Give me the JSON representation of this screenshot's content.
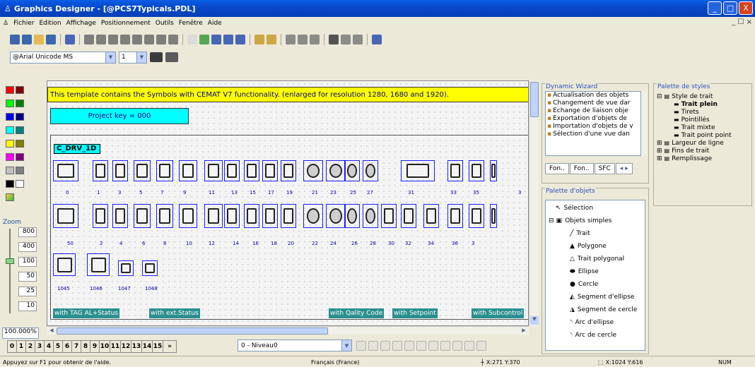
{
  "window": {
    "title": "Graphics Designer - [@PCS7Typicals.PDL]",
    "min": "_",
    "max": "□",
    "close": "X",
    "mdi_controls": "_ ☐ ×"
  },
  "menu": [
    "Fichier",
    "Edition",
    "Affichage",
    "Positionnement",
    "Outils",
    "Fenêtre",
    "Aide"
  ],
  "format_bar": {
    "font": "@Arial Unicode MS",
    "line_width": "1"
  },
  "canvas": {
    "banner": "This template contains the Symbols with CEMAT V7 functionality. (enlarged for  resolution 1280, 1680 and 1920).",
    "project_key": "Project key = 000",
    "group_label": "C_DRV_1D",
    "row1_numbers": [
      "0",
      "1",
      "3",
      "5",
      "7",
      "9",
      "11",
      "13",
      "15",
      "17",
      "19",
      "21",
      "23",
      "25",
      "27",
      "31",
      "33",
      "35",
      "3"
    ],
    "row2_numbers": [
      "50",
      "2",
      "4",
      "6",
      "8",
      "10",
      "12",
      "14",
      "16",
      "18",
      "20",
      "22",
      "24",
      "26",
      "28",
      "30",
      "32",
      "34",
      "36",
      "3"
    ],
    "row3_numbers": [
      "1045",
      "1046",
      "1047",
      "1048"
    ],
    "tags": [
      "with TAG  AL+Status",
      "with ext.Status",
      "with Qality Code",
      "with Setpoint",
      "with Subcontrol"
    ]
  },
  "zoom": {
    "label": "Zoom",
    "levels": [
      "800",
      "400",
      "100",
      "50",
      "25",
      "10"
    ],
    "value": "100.000",
    "unit": "%"
  },
  "dynamic_wizard": {
    "title": "Dynamic Wizard",
    "items": [
      "Actualisation des objets",
      "Changement de vue dar",
      "Echange de liaison obje",
      "Exportation d'objets de",
      "Importation d'objets de v",
      "Sélection d'une vue dan"
    ],
    "tabs": [
      "Fon..",
      "Fon..",
      "SFC"
    ]
  },
  "style_palette": {
    "title": "Palette de styles",
    "items": [
      {
        "label": "Style de trait",
        "level": 0,
        "expanded": true
      },
      {
        "label": "Trait plein",
        "level": 1,
        "bold": true
      },
      {
        "label": "Tirets",
        "level": 1
      },
      {
        "label": "Pointillés",
        "level": 1
      },
      {
        "label": "Trait mixte",
        "level": 1
      },
      {
        "label": "Trait point point",
        "level": 1
      },
      {
        "label": "Largeur de ligne",
        "level": 0
      },
      {
        "label": "Fins de trait",
        "level": 0
      },
      {
        "label": "Remplissage",
        "level": 0
      }
    ]
  },
  "object_palette": {
    "title": "Palette d'objets",
    "items": [
      {
        "label": "Sélection",
        "level": 0,
        "icon": "cursor-icon"
      },
      {
        "label": "Objets simples",
        "level": 0,
        "icon": "folder-icon"
      },
      {
        "label": "Trait",
        "level": 1,
        "icon": "line-icon"
      },
      {
        "label": "Polygone",
        "level": 1,
        "icon": "polygon-icon"
      },
      {
        "label": "Trait polygonal",
        "level": 1,
        "icon": "polyline-icon"
      },
      {
        "label": "Ellipse",
        "level": 1,
        "icon": "ellipse-icon"
      },
      {
        "label": "Cercle",
        "level": 1,
        "icon": "circle-icon"
      },
      {
        "label": "Segment d'ellipse",
        "level": 1,
        "icon": "ellipse-segment-icon"
      },
      {
        "label": "Segment de cercle",
        "level": 1,
        "icon": "circle-segment-icon"
      },
      {
        "label": "Arc d'ellipse",
        "level": 1,
        "icon": "ellipse-arc-icon"
      },
      {
        "label": "Arc de cercle",
        "level": 1,
        "icon": "circle-arc-icon"
      }
    ]
  },
  "layers": {
    "pages": [
      "0",
      "1",
      "2",
      "3",
      "4",
      "5",
      "6",
      "7",
      "8",
      "9",
      "10",
      "11",
      "12",
      "13",
      "14",
      "15"
    ],
    "more": "»",
    "level": "0 - Niveau0"
  },
  "status": {
    "help": "Appuyez sur F1 pour obtenir de l'aide.",
    "language": "Français (France)",
    "cursor": "X:271 Y:370",
    "size": "X:1024 Y:616",
    "num": "NUM"
  }
}
